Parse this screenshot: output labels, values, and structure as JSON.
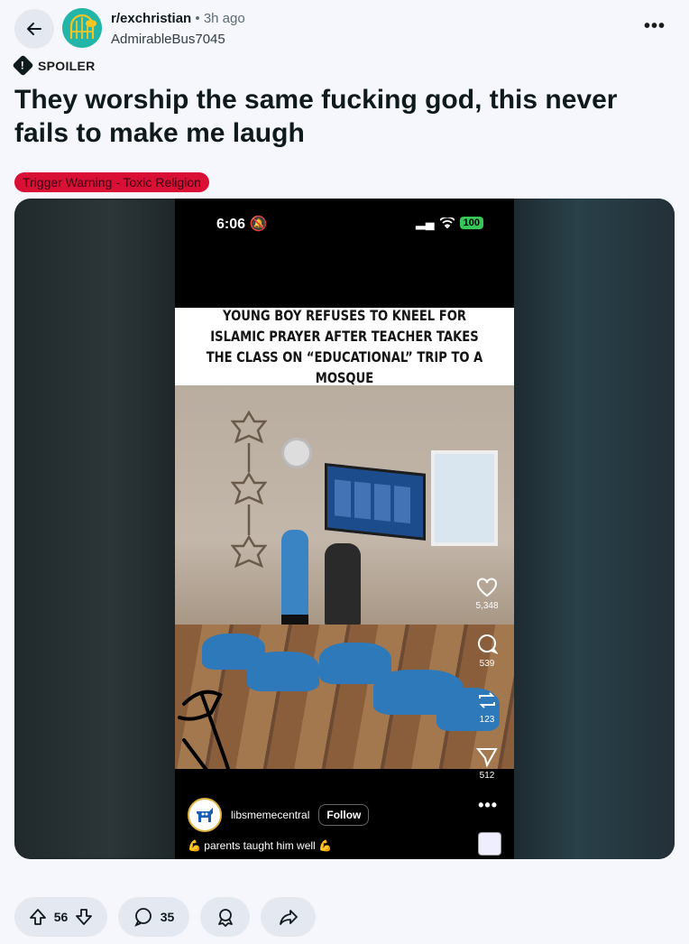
{
  "header": {
    "subreddit": "r/exchristian",
    "separator": "•",
    "time": "3h ago",
    "author": "AdmirableBus7045"
  },
  "post": {
    "spoiler_label": "SPOILER",
    "title": "They worship the same fucking god, this never fails to make me laugh",
    "flair": "Trigger Warning - Toxic Religion"
  },
  "video": {
    "status_time": "6:06",
    "battery": "100",
    "headline": "YOUNG BOY REFUSES TO KNEEL FOR ISLAMIC PRAYER AFTER TEACHER TAKES THE CLASS ON “EDUCATIONAL” TRIP TO A MOSQUE",
    "likes": "5,348",
    "comments": "539",
    "reposts": "123",
    "shares": "512",
    "account": "libsmemecentral",
    "follow_label": "Follow",
    "caption": "parents taught him well"
  },
  "actions": {
    "votes": "56",
    "comments": "35"
  },
  "colors": {
    "background": "#f5f7fc",
    "pill": "#e4e9f1",
    "flair": "#d90f36",
    "avatar": "#23b5a8"
  },
  "icons": [
    "back-arrow-icon",
    "more-icon",
    "spoiler-icon",
    "upvote-icon",
    "downvote-icon",
    "comment-icon",
    "award-icon",
    "share-icon"
  ]
}
